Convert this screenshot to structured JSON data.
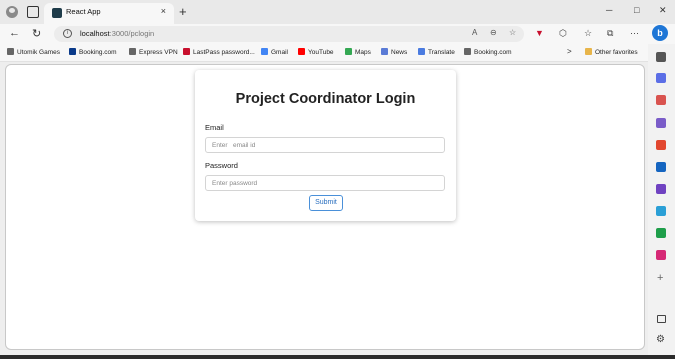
{
  "browser": {
    "tab_title": "React App",
    "tab_close": "×",
    "new_tab": "+",
    "window_controls": [
      "─",
      "□",
      "✕"
    ],
    "nav": {
      "back": "←",
      "refresh": "↻"
    },
    "url": {
      "host": "localhost",
      "path": ":3000/pclogin"
    },
    "copilot": "b",
    "bookmarks": [
      {
        "label": "Utomik Games",
        "color": "#666666"
      },
      {
        "label": "Booking.com",
        "color": "#0a3a8a"
      },
      {
        "label": "Express VPN",
        "color": "#666666"
      },
      {
        "label": "LastPass password...",
        "color": "#c8102e"
      },
      {
        "label": "Gmail",
        "color": "#4285f4"
      },
      {
        "label": "YouTube",
        "color": "#ff0000"
      },
      {
        "label": "Maps",
        "color": "#34a853"
      },
      {
        "label": "News",
        "color": "#5a7bd6"
      },
      {
        "label": "Translate",
        "color": "#4a7be0"
      },
      {
        "label": "Booking.com",
        "color": "#666666"
      }
    ],
    "bookmarks_more": ">",
    "other_favorites": "Other favorites",
    "sidebar_icons": [
      {
        "name": "search-icon",
        "color": "#555555"
      },
      {
        "name": "tag-icon",
        "color": "#5b6ee6"
      },
      {
        "name": "briefcase-icon",
        "color": "#d9534f"
      },
      {
        "name": "people-icon",
        "color": "#7a5cc8"
      },
      {
        "name": "office-icon",
        "color": "#e2472f"
      },
      {
        "name": "outlook-icon",
        "color": "#1565c0"
      },
      {
        "name": "designer-icon",
        "color": "#6f42c1"
      },
      {
        "name": "shopping-icon",
        "color": "#2a9fd6"
      },
      {
        "name": "tree-icon",
        "color": "#1e9e4a"
      },
      {
        "name": "instagram-icon",
        "color": "#d62976"
      }
    ]
  },
  "login": {
    "title": "Project Coordinator Login",
    "email_label": "Email",
    "email_placeholder": "Enter   email id",
    "password_label": "Password",
    "password_placeholder": "Enter password",
    "submit_label": "Submit"
  }
}
